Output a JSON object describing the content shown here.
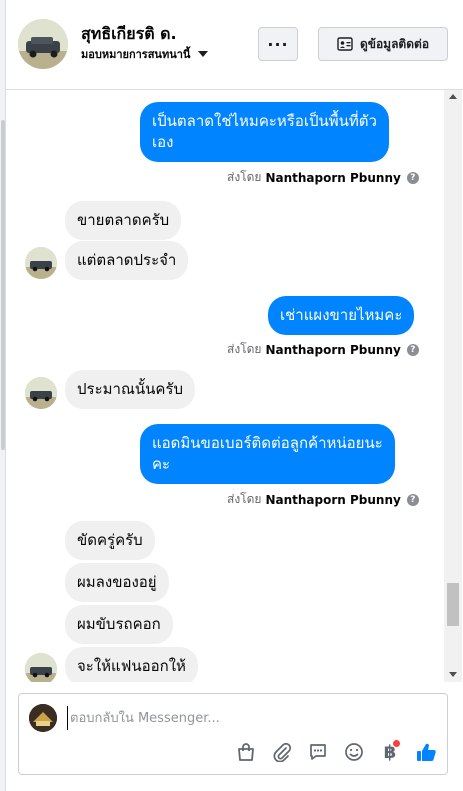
{
  "header": {
    "name": "สุทธิเกียรติ ด.",
    "assign_label": "มอบหมายการสนทนานี้",
    "more_label": "···",
    "contact_label": "ดูข้อมูลติดต่อ"
  },
  "messages": [
    {
      "dir": "out",
      "lines": [
        "เป็นตลาดใช่ไหมคะหรือเป็นพื้นที่ตัว",
        "เอง"
      ]
    },
    {
      "dir": "in",
      "text": "ขายตลาดครับ"
    },
    {
      "dir": "in",
      "text": "แต่ตลาดประจำ"
    },
    {
      "dir": "out",
      "text": "เช่าแผงขายไหมคะ"
    },
    {
      "dir": "in",
      "text": "ประมาณนั้นครับ"
    },
    {
      "dir": "out",
      "lines": [
        "แอดมินขอเบอร์ติดต่อลูกค้าหน่อยนะ",
        "คะ"
      ]
    },
    {
      "dir": "in",
      "text": "ขัดครู่ครับ"
    },
    {
      "dir": "in",
      "text": "ผมลงของอยู่"
    },
    {
      "dir": "in",
      "text": "ผมขับรถคอก"
    },
    {
      "dir": "in",
      "text": "จะให้แฟนออกให้"
    }
  ],
  "sent_by": {
    "prefix": "ส่งโดย",
    "author": "Nanthaporn Pbunny",
    "info": "?"
  },
  "composer": {
    "placeholder": "ตอบกลับใน Messenger..."
  },
  "colors": {
    "outgoing": "#0084ff",
    "incoming": "#f0f0f0",
    "like": "#0084ff",
    "badge": "#fa3e3e"
  },
  "icons": [
    "shopping-bag-icon",
    "paperclip-icon",
    "quick-reply-icon",
    "emoji-icon",
    "baht-payment-icon",
    "thumbs-up-icon"
  ],
  "baht_symbol": "฿"
}
